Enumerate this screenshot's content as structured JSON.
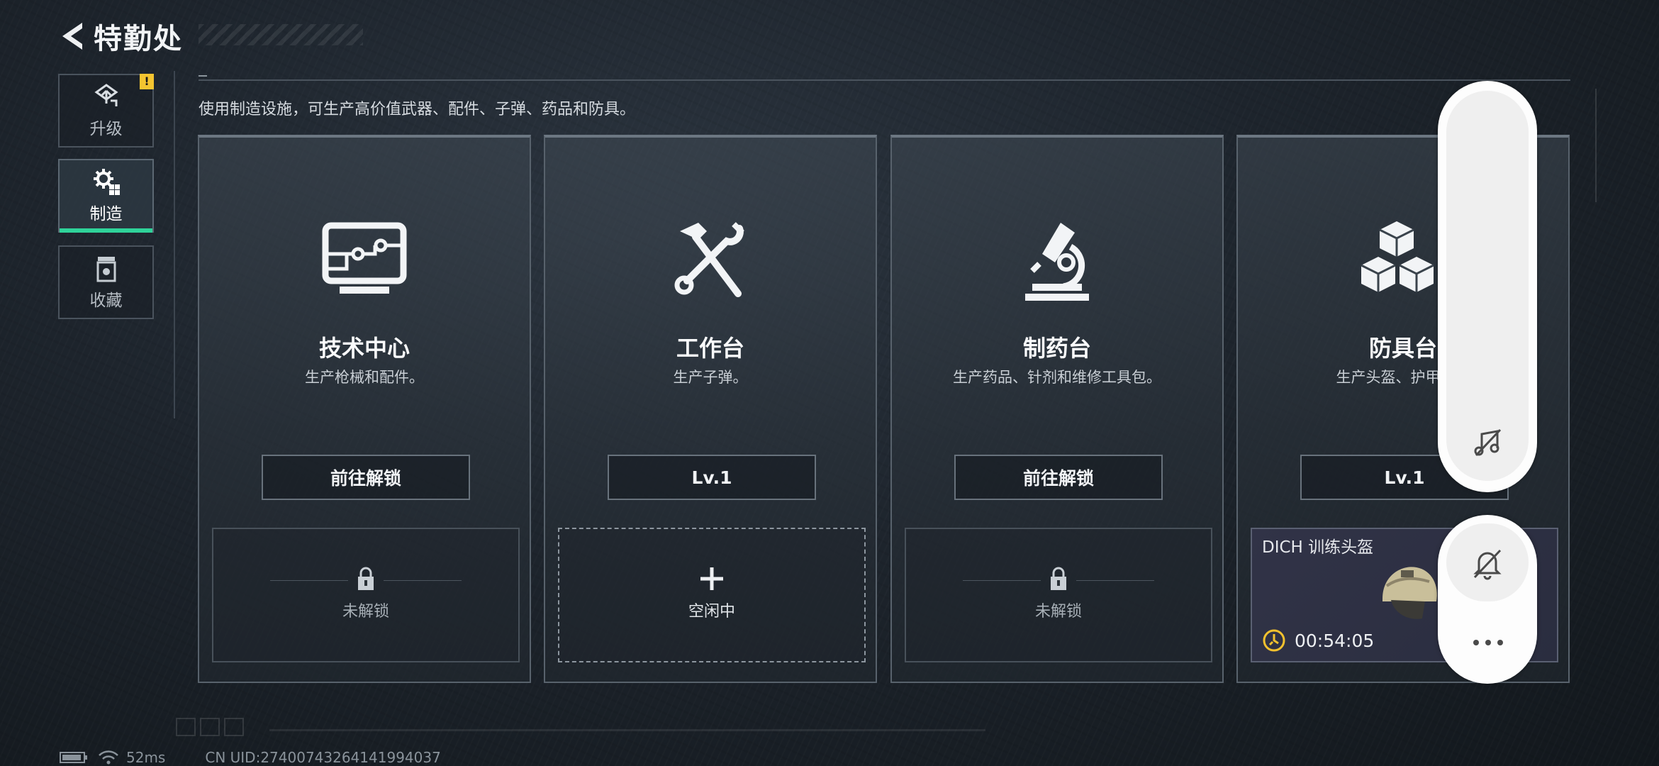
{
  "header": {
    "title": "特勤处",
    "back_icon": "back-arrow-icon"
  },
  "sidebar": {
    "items": [
      {
        "label": "升级",
        "icon": "upgrade-icon",
        "badge": "!",
        "active": false
      },
      {
        "label": "制造",
        "icon": "gear-craft-icon",
        "active": true
      },
      {
        "label": "收藏",
        "icon": "collection-icon",
        "active": false
      }
    ]
  },
  "main": {
    "subtitle": "使用制造设施，可生产高价值武器、配件、子弹、药品和防具。",
    "cards": [
      {
        "title": "技术中心",
        "desc": "生产枪械和配件。",
        "button": "前往解锁",
        "icon": "monitor-circuit-icon",
        "slot_status": "未解锁"
      },
      {
        "title": "工作台",
        "desc": "生产子弹。",
        "button": "Lv.1",
        "icon": "hammer-wrench-icon",
        "slot_status": "空闲中"
      },
      {
        "title": "制药台",
        "desc": "生产药品、针剂和维修工具包。",
        "button": "前往解锁",
        "icon": "microscope-icon",
        "slot_status": "未解锁"
      },
      {
        "title": "防具台",
        "desc": "生产头盔、护甲、胸",
        "button": "Lv.1",
        "icon": "cubes-icon",
        "crafting": {
          "item": "DICH 训练头盔",
          "timer": "00:54:05"
        }
      }
    ]
  },
  "status_bar": {
    "ping": "52ms",
    "uid": "CN UID:27400743264141994037"
  },
  "colors": {
    "active_accent": "#2fd39a",
    "alert": "#f4c430",
    "timer_icon": "#f2c12e"
  }
}
